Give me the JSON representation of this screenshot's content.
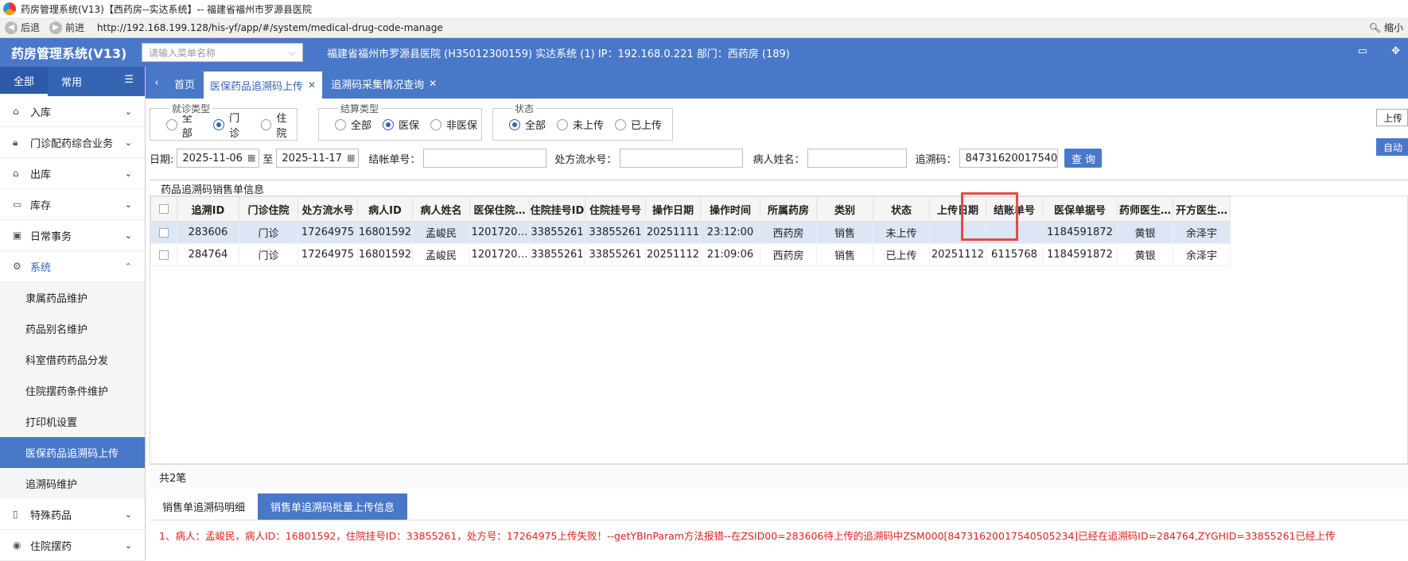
{
  "window": {
    "title": "药房管理系统(V13)【西药房--实达系统】-- 福建省福州市罗源县医院"
  },
  "browser": {
    "back": "后退",
    "forward": "前进",
    "url": "http://192.168.199.128/his-yf/app/#/system/medical-drug-code-manage",
    "zoom": "缩小"
  },
  "topbar": {
    "app_title": "药房管理系统(V13)",
    "menu_placeholder": "请输入菜单名称",
    "hospital_info": "福建省福州市罗源县医院 (H35012300159) 实达系统 (1) IP：192.168.0.221 部门：西药房 (189)"
  },
  "sidebar": {
    "tabs": [
      "全部",
      "常用"
    ],
    "items": [
      {
        "label": "入库",
        "icon": "inbox-icon"
      },
      {
        "label": "门诊配药综合业务",
        "icon": "lock-icon"
      },
      {
        "label": "出库",
        "icon": "outbox-icon"
      },
      {
        "label": "库存",
        "icon": "inventory-icon"
      },
      {
        "label": "日常事务",
        "icon": "calendar-icon"
      },
      {
        "label": "系统",
        "icon": "gear-icon"
      }
    ],
    "sub_items": [
      "隶属药品维护",
      "药品别名维护",
      "科室借药药品分发",
      "住院摆药条件维护",
      "打印机设置",
      "医保药品追溯码上传",
      "追溯码维护"
    ],
    "bottom_items": [
      {
        "label": "特殊药品"
      },
      {
        "label": "住院摆药"
      }
    ]
  },
  "page_tabs": [
    {
      "label": "首页"
    },
    {
      "label": "医保药品追溯码上传"
    },
    {
      "label": "追溯码采集情况查询"
    }
  ],
  "filters": {
    "visit_type": {
      "title": "就诊类型",
      "options": [
        "全部",
        "门诊",
        "住院"
      ]
    },
    "settle_type": {
      "title": "结算类型",
      "options": [
        "全部",
        "医保",
        "非医保"
      ]
    },
    "status": {
      "title": "状态",
      "options": [
        "全部",
        "未上传",
        "已上传"
      ]
    },
    "date_label": "日期:",
    "date_from": "2025-11-06",
    "to_label": "至",
    "date_to": "2025-11-17",
    "settle_no_label": "结帐单号：",
    "rx_no_label": "处方流水号：",
    "patient_name_label": "病人姓名：",
    "trace_code_label": "追溯码：",
    "trace_code_value": "84731620017540",
    "query_btn": "查 询",
    "upload_btn": "上传",
    "auto_btn": "自动"
  },
  "section_title": "药品追溯码销售单信息",
  "table": {
    "headers": [
      "追溯ID",
      "门诊住院",
      "处方流水号",
      "病人ID",
      "病人姓名",
      "医保住院…",
      "住院挂号ID",
      "住院挂号号",
      "操作日期",
      "操作时间",
      "所属药房",
      "类别",
      "状态",
      "上传日期",
      "结账单号",
      "医保单据号",
      "药师医生…",
      "开方医生…"
    ],
    "rows": [
      [
        "283606",
        "门诊",
        "17264975",
        "16801592",
        "孟峻民",
        "1201720…",
        "33855261",
        "33855261",
        "20251111",
        "23:12:00",
        "西药房",
        "销售",
        "未上传",
        "",
        "",
        "1184591872",
        "黄银",
        "余泽宇"
      ],
      [
        "284764",
        "门诊",
        "17264975",
        "16801592",
        "孟峻民",
        "1201720…",
        "33855261",
        "33855261",
        "20251112",
        "21:09:06",
        "西药房",
        "销售",
        "已上传",
        "20251112",
        "6115768",
        "1184591872",
        "黄银",
        "余泽宇"
      ]
    ],
    "footer": "共2笔"
  },
  "bottom_tabs": [
    {
      "label": "销售单追溯码明细"
    },
    {
      "label": "销售单追溯码批量上传信息"
    }
  ],
  "error_message": "1、病人：孟峻民，病人ID：16801592，住院挂号ID：33855261，处方号：17264975上传失败！--getYBInParam方法报错--在ZSID00=283606待上传的追溯码中ZSM000[84731620017540505234]已经在追溯码ID=284764,ZYGHID=33855261已经上传"
}
